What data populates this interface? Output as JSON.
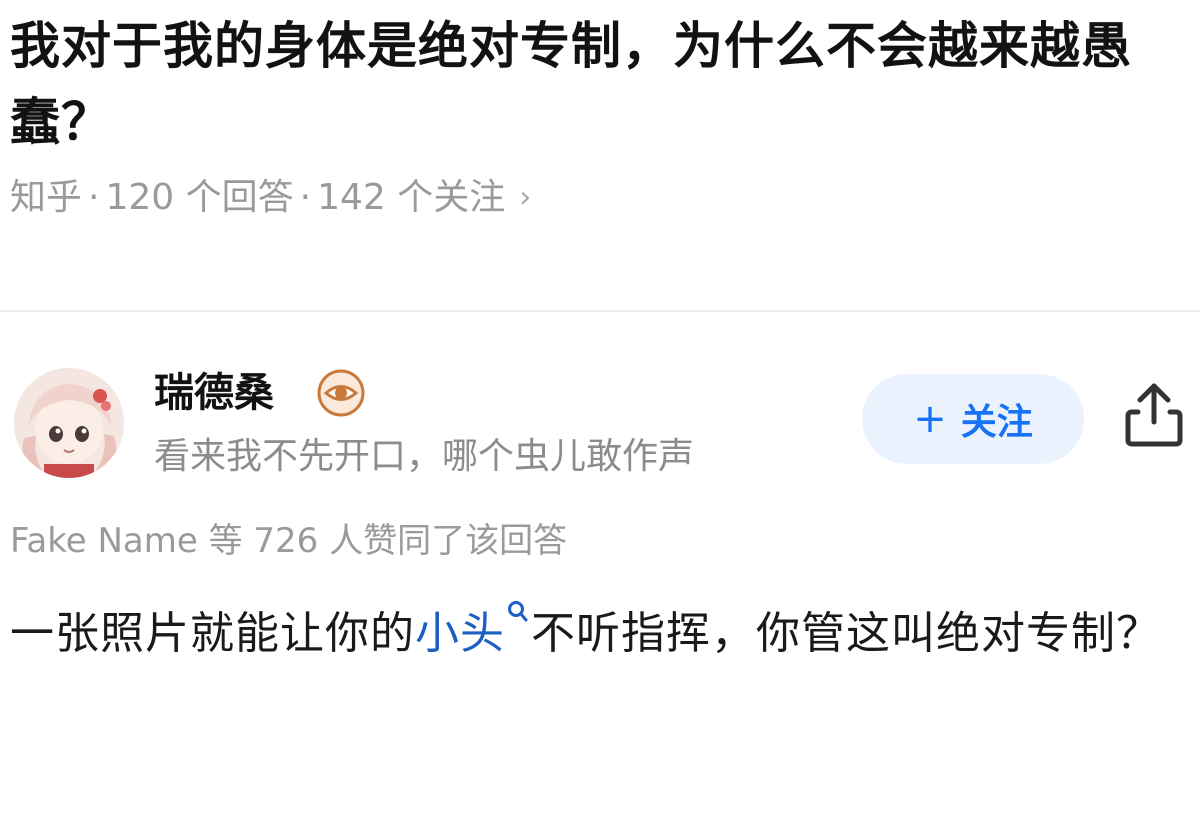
{
  "question": {
    "title": "我对于我的身体是绝对专制，为什么不会越来越愚蠢？",
    "source": "知乎",
    "separator": "·",
    "answers_count": "120 个回答",
    "followers_count": "142 个关注",
    "chevron": "›"
  },
  "author": {
    "name": "瑞德桑",
    "badge_icon": "eye-badge-icon",
    "bio": "看来我不先开口，哪个虫儿敢作声",
    "follow_label": "关注",
    "follow_plus": "+",
    "share_icon": "share-icon"
  },
  "answer": {
    "likes_text": "Fake Name 等 726 人赞同了该回答",
    "text_before": "一张照片就能让你的",
    "link_text": "小头",
    "text_after": "不听指挥，你管这叫绝对专制？"
  },
  "colors": {
    "accent": "#1772f6",
    "follow_bg": "#eaf2fd",
    "link": "#1d5fc3",
    "muted": "#9a9a9a",
    "badge": "#c97a3a"
  }
}
